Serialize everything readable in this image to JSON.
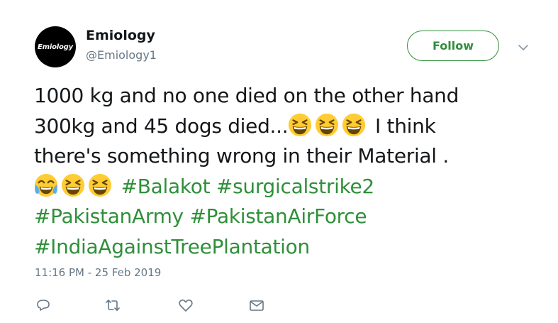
{
  "author": {
    "avatar_text": "Emiology",
    "display_name": "Emiology",
    "handle": "@Emiology1"
  },
  "follow_button": {
    "label": "Follow"
  },
  "tweet": {
    "line1": "1000 kg and no one died on the other hand",
    "line2_text": "300kg and 45 dogs died...",
    "line2_suffix": " I think",
    "line3": "there's something wrong in their Material .",
    "hashtags": {
      "balakot": "#Balakot",
      "surgicalstrike2": "#surgicalstrike2",
      "pakistanarmy": "#PakistanArmy",
      "pakistanairforce": "#PakistanAirForce",
      "indiaagainsttreeplantation": "#IndiaAgainstTreePlantation"
    },
    "emojis": [
      "grinning-squinting-face",
      "grinning-squinting-face",
      "grinning-squinting-face",
      "face-with-tears-of-joy",
      "grinning-squinting-face",
      "grinning-squinting-face"
    ]
  },
  "timestamp": "11:16 PM - 25 Feb 2019",
  "actions": [
    "reply-icon",
    "retweet-icon",
    "like-icon",
    "direct-message-icon"
  ],
  "colors": {
    "accent": "#2f8f3a",
    "text": "#14171a",
    "muted": "#657786",
    "emoji_face": "#ffcc33"
  }
}
